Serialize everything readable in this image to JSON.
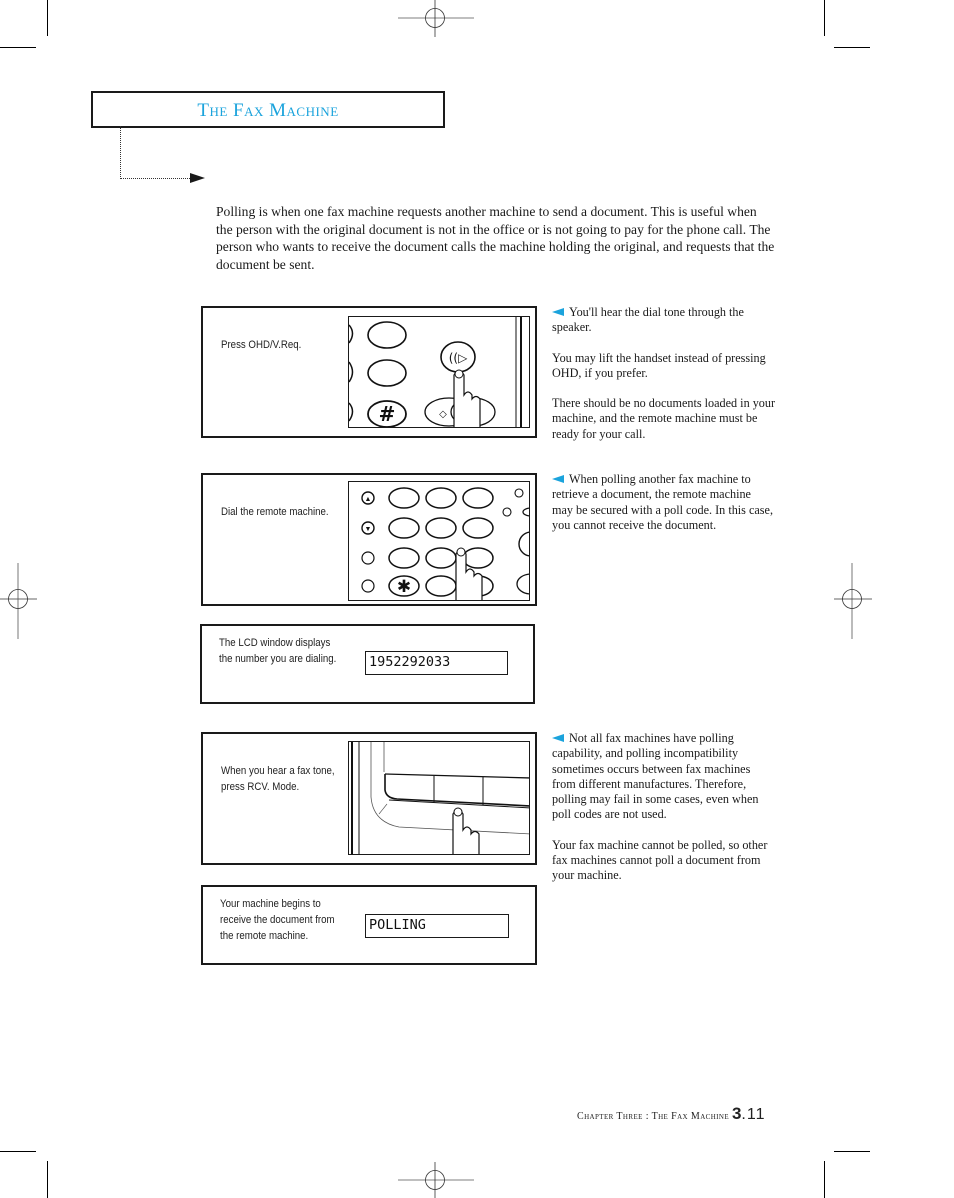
{
  "header": {
    "title": "The Fax Machine"
  },
  "intro": {
    "text": "Polling is when one fax machine requests another machine to send a document. This is useful when the person with the original document is not in the office or is not going to pay for the phone call. The person who wants to receive the document calls the machine holding the original, and requests that the document be sent."
  },
  "steps": [
    {
      "label": "Press OHD/V.Req.",
      "illustration": "ohd-button-press"
    },
    {
      "label": "Dial the remote machine.",
      "illustration": "keypad-dial"
    },
    {
      "label": "The LCD window displays the number you are dialing.",
      "lcd": "1952292033"
    },
    {
      "label": "When you hear a fax tone, press RCV. Mode.",
      "illustration": "rcv-mode-press"
    },
    {
      "label": "Your machine begins to receive the document from the remote machine.",
      "lcd": "POLLING"
    }
  ],
  "notes": [
    {
      "paragraphs": [
        "You'll hear the dial tone through the speaker.",
        "You may lift the handset instead of pressing OHD, if you prefer.",
        "There should be no documents loaded in your machine, and the remote machine must be ready for your call."
      ]
    },
    {
      "paragraphs": [
        "When polling another fax machine to retrieve a document, the remote machine may be secured with a poll code. In this case, you cannot receive the document."
      ]
    },
    {
      "paragraphs": [
        "Not all fax machines have polling capability, and polling incompatibility sometimes occurs between fax machines from different manufactures. Therefore, polling may fail in some cases, even when poll codes are not used.",
        "Your fax machine cannot be polled, so other fax machines cannot poll a document from your machine."
      ]
    }
  ],
  "footer": {
    "running_head": "Chapter Three : The Fax Machine",
    "page_major": "3",
    "page_minor": ".11"
  },
  "colors": {
    "accent": "#1ba3dc",
    "ink": "#1a1a1a"
  }
}
